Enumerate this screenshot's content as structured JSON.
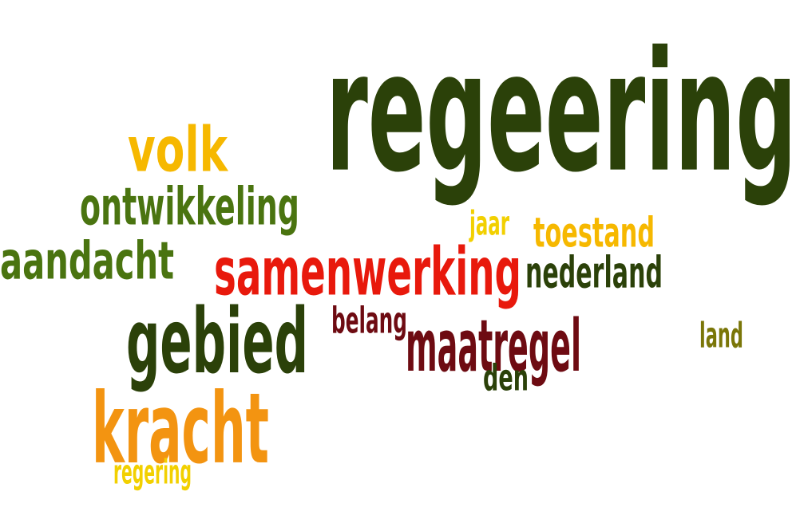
{
  "word_cloud": {
    "words": [
      {
        "text": "regeering",
        "color": "#2b4109"
      },
      {
        "text": "volk",
        "color": "#f6b800"
      },
      {
        "text": "ontwikkeling",
        "color": "#4a7410"
      },
      {
        "text": "aandacht",
        "color": "#4a7410"
      },
      {
        "text": "samenwerking",
        "color": "#e8190c"
      },
      {
        "text": "jaar",
        "color": "#f2d000"
      },
      {
        "text": "toestand",
        "color": "#f6b800"
      },
      {
        "text": "nederland",
        "color": "#2b4109"
      },
      {
        "text": "gebied",
        "color": "#2b4109"
      },
      {
        "text": "belang",
        "color": "#6e0b12"
      },
      {
        "text": "maatregel",
        "color": "#6e0b12"
      },
      {
        "text": "land",
        "color": "#7a7608"
      },
      {
        "text": "den",
        "color": "#2b4109"
      },
      {
        "text": "kracht",
        "color": "#f39411"
      },
      {
        "text": "regering",
        "color": "#f2d000"
      }
    ]
  }
}
